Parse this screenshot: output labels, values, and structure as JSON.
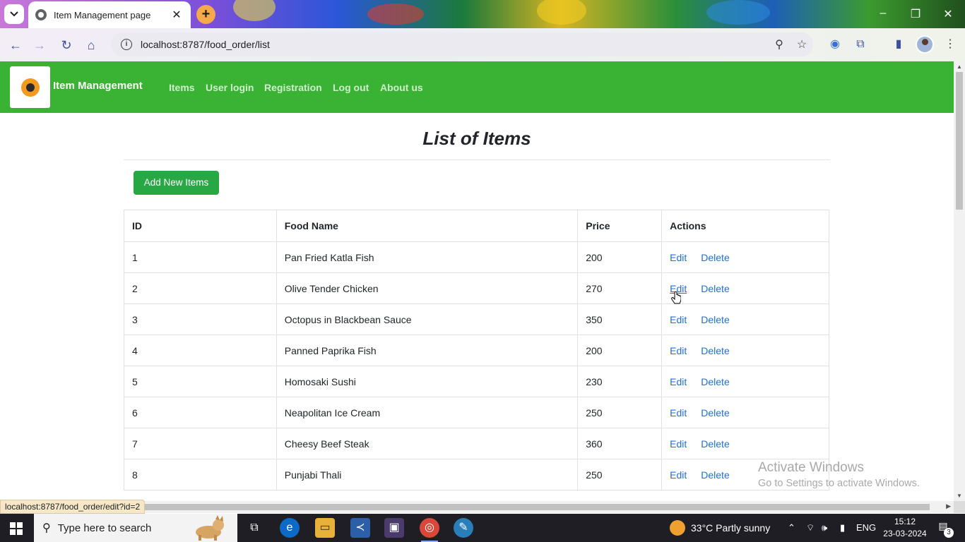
{
  "browser": {
    "tab_title": "Item Management page",
    "url": "localhost:8787/food_order/list",
    "status_url": "localhost:8787/food_order/edit?id=2"
  },
  "navbar": {
    "brand": "Item Management",
    "links": [
      "Items",
      "User login",
      "Registration",
      "Log out",
      "About us"
    ],
    "bg_color": "#3ab234"
  },
  "page": {
    "title": "List of Items",
    "add_button": "Add New Items"
  },
  "table": {
    "headers": [
      "ID",
      "Food Name",
      "Price",
      "Actions"
    ],
    "edit_label": "Edit",
    "delete_label": "Delete",
    "rows": [
      {
        "id": "1",
        "name": "Pan Fried Katla Fish",
        "price": "200"
      },
      {
        "id": "2",
        "name": "Olive Tender Chicken",
        "price": "270"
      },
      {
        "id": "3",
        "name": "Octopus in Blackbean Sauce",
        "price": "350"
      },
      {
        "id": "4",
        "name": "Panned Paprika Fish",
        "price": "200"
      },
      {
        "id": "5",
        "name": "Homosaki Sushi",
        "price": "230"
      },
      {
        "id": "6",
        "name": "Neapolitan Ice Cream",
        "price": "250"
      },
      {
        "id": "7",
        "name": "Cheesy Beef Steak",
        "price": "360"
      },
      {
        "id": "8",
        "name": "Punjabi Thali",
        "price": "250"
      }
    ]
  },
  "watermark": {
    "line1": "Activate Windows",
    "line2": "Go to Settings to activate Windows."
  },
  "taskbar": {
    "search_placeholder": "Type here to search",
    "weather": "33°C  Partly sunny",
    "language": "ENG",
    "time": "15:12",
    "date": "23-03-2024",
    "notification_count": "3"
  }
}
